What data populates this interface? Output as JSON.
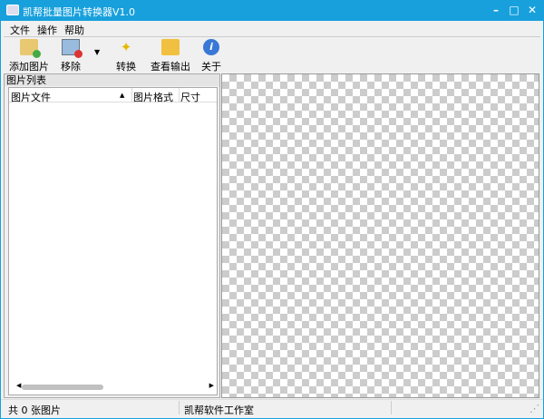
{
  "window": {
    "title": "凯帮批量图片转换器V1.0",
    "buttons": [
      "minimize",
      "maximize",
      "close"
    ]
  },
  "menu": [
    "文件",
    "操作",
    "帮助"
  ],
  "toolbar": [
    {
      "label": "添加图片",
      "icon": "add-folder-icon"
    },
    {
      "label": "移除",
      "icon": "remove-image-icon"
    },
    {
      "label": "转换",
      "icon": "magic-wand-icon"
    },
    {
      "label": "查看输出",
      "icon": "open-folder-icon"
    },
    {
      "label": "关于",
      "icon": "info-icon"
    }
  ],
  "panel": {
    "title": "图片列表",
    "columns": [
      "图片文件",
      "图片格式",
      "尺寸"
    ]
  },
  "status": {
    "count": "共 0 张图片",
    "studio": "凯帮软件工作室"
  },
  "colors": {
    "titlebar": "#17a0dc"
  }
}
